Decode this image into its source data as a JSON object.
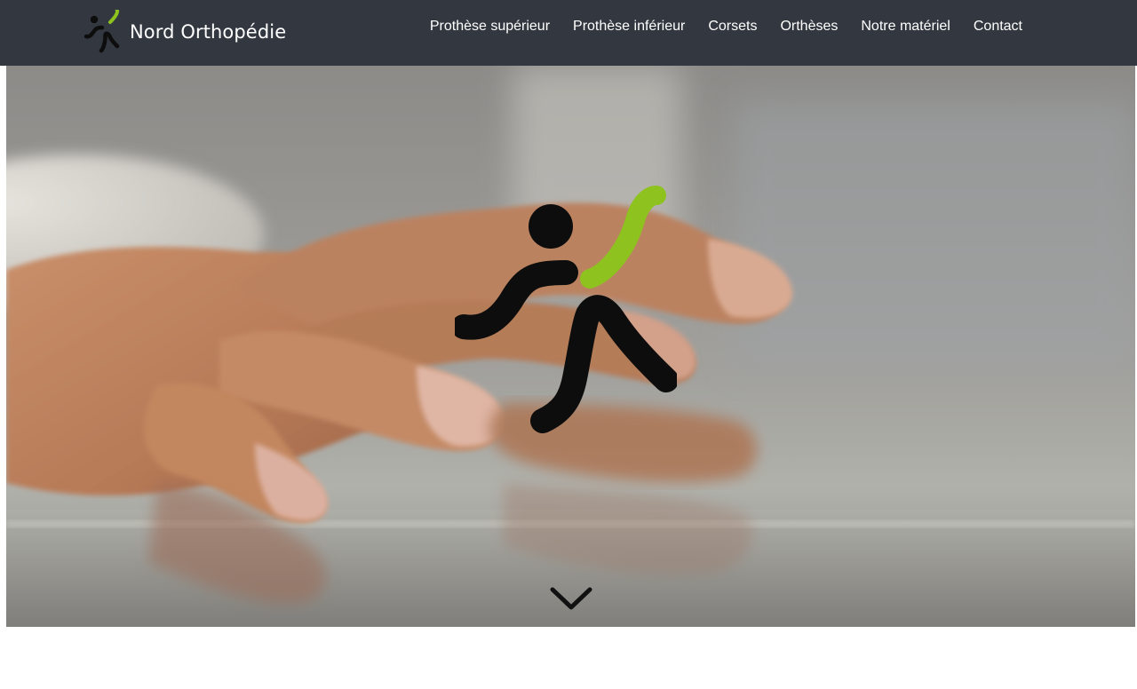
{
  "header": {
    "brand_name": "Nord Orthopédie",
    "logo_icon": "running-figure-logo",
    "nav": [
      {
        "label": "Prothèse supérieur"
      },
      {
        "label": "Prothèse inférieur"
      },
      {
        "label": "Corsets"
      },
      {
        "label": "Orthèses"
      },
      {
        "label": "Notre matériel"
      },
      {
        "label": "Contact"
      }
    ]
  },
  "hero": {
    "image": "hand-on-table-photo",
    "overlay_icon": "running-figure-logo",
    "scroll_icon": "chevron-down-icon"
  },
  "colors": {
    "navbar": "#333840",
    "accent_green": "#8dc21f",
    "figure_black": "#0d0d0d",
    "text": "#ffffff"
  }
}
